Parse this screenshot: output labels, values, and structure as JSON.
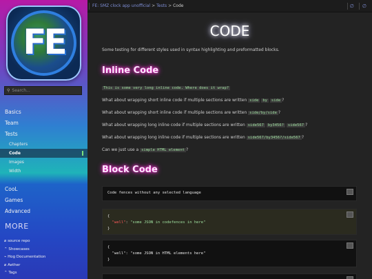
{
  "sidebar": {
    "logo_text": "FE",
    "search_placeholder": "Search...",
    "nav": [
      {
        "label": "Basics"
      },
      {
        "label": "Team"
      },
      {
        "label": "Tests"
      }
    ],
    "tests_children": [
      "Chapters",
      "Code",
      "Images",
      "Width"
    ],
    "active_child": "Code",
    "nav2": [
      {
        "label": "CooL"
      },
      {
        "label": "Games"
      },
      {
        "label": "Advanced"
      }
    ],
    "more_label": "MORE",
    "more_links": [
      "source repo",
      "Showcases",
      "Hog Documentation",
      "Aether",
      "Tags"
    ]
  },
  "topbar": {
    "crumb_app": "FE: SMZ clock app unofficial",
    "crumb_sep1": ">",
    "crumb_tests": "Tests",
    "crumb_sep2": ">",
    "crumb_current": "Code"
  },
  "content": {
    "title": "CODE",
    "intro": "Some testing for different styles used in syntax highlighting and preformatted blocks.",
    "inline_heading": "Inline Code",
    "inline_long": "This is some very long inline code. Where does it wrap?",
    "p1_pre": "What about wrapping short inline code if multiple sections are written",
    "p1_c1": "side",
    "p1_c2": "by",
    "p1_c3": "side",
    "p2_pre": "What about wrapping short inline code if multiple sections are written",
    "p2_code": "side/by/side",
    "p3_pre": "What about wrapping long inline code if multiple sections are written",
    "p3_c1": "side567",
    "p3_c2": "by3456?",
    "p3_c3": "side567",
    "p4_pre": "What about wrapping long inline code if multiple sections are written",
    "p4_code": "side567/by3456?/side567",
    "p5_pre": "Can we just use a",
    "p5_code": "simple HTML element",
    "block_heading": "Block Code",
    "block1": "Code fences without any selected language",
    "block2_key": "\"well\"",
    "block2_val": "\"some JSON in codefences in here\"",
    "block3_key": "\"well\"",
    "block3_val": "\"some JSON in HTML elements here\""
  }
}
